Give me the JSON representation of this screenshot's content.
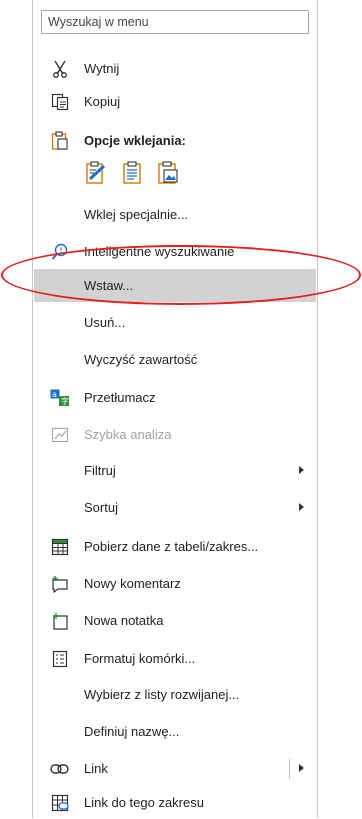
{
  "search": {
    "placeholder": "Wyszukaj w menu"
  },
  "items": {
    "cut": "Wytnij",
    "copy": "Kopiuj",
    "paste_options": "Opcje wklejania:",
    "paste_special": "Wklej specjalnie...",
    "smart_lookup": "Inteligentne wyszukiwanie",
    "insert": "Wstaw...",
    "delete": "Usuń...",
    "clear": "Wyczyść zawartość",
    "translate": "Przetłumacz",
    "quick_analysis": "Szybka analiza",
    "filter": "Filtruj",
    "sort": "Sortuj",
    "get_data": "Pobierz dane z tabeli/zakres...",
    "new_comment": "Nowy komentarz",
    "new_note": "Nowa notatka",
    "format_cells": "Formatuj komórki...",
    "pick_list": "Wybierz z listy rozwijanej...",
    "define_name": "Definiuj nazwę...",
    "link": "Link",
    "link_to_range": "Link do tego zakresu"
  },
  "colors": {
    "selected_bg": "#d2d2d2",
    "highlight_ellipse": "#e22020",
    "icon_green": "#2e8b3a",
    "icon_blue": "#1e6fc8",
    "icon_orange": "#d17a00"
  }
}
